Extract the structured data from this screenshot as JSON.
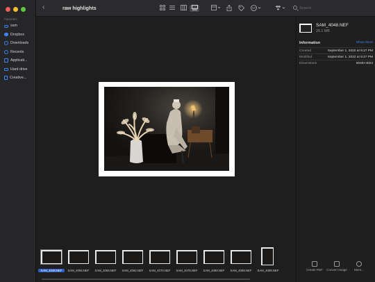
{
  "window": {
    "title": "raw highlights"
  },
  "sidebar": {
    "section": "Favorites",
    "items": [
      {
        "label": "sam",
        "icon": "cloud-icon"
      },
      {
        "label": "Dropbox",
        "icon": "dropbox-icon"
      },
      {
        "label": "Downloads",
        "icon": "downloads-icon"
      },
      {
        "label": "Recents",
        "icon": "clock-icon"
      },
      {
        "label": "Applicati...",
        "icon": "applications-icon"
      },
      {
        "label": "Hard drive",
        "icon": "drive-icon"
      },
      {
        "label": "Creative...",
        "icon": "document-icon"
      }
    ]
  },
  "toolbar": {
    "back_glyph": "‹",
    "search_placeholder": "Search",
    "icons": [
      "icon-view-icon",
      "list-view-icon",
      "column-view-icon",
      "gallery-view-icon",
      "group-icon",
      "share-icon",
      "tag-icon",
      "action-icon",
      "dropbox-icon",
      "search-icon"
    ]
  },
  "inspector": {
    "file_name": "SAM_4048.NEF",
    "file_size": "26.1 MB",
    "info_title": "Information",
    "show_more": "Show More",
    "rows": [
      {
        "key": "Created",
        "value": "September 1, 2022 at 9:27 PM"
      },
      {
        "key": "Modified",
        "value": "September 1, 2022 at 9:27 PM"
      },
      {
        "key": "Dimensions",
        "value": "6048×4024"
      }
    ],
    "actions": [
      {
        "label": "Create PDF"
      },
      {
        "label": "Convert Image"
      },
      {
        "label": "More..."
      }
    ]
  },
  "filmstrip": {
    "items": [
      {
        "label": "SAM_4048.NEF",
        "selected": true
      },
      {
        "label": "SAM_4056.NEF"
      },
      {
        "label": "SAM_4059.NEF"
      },
      {
        "label": "SAM_4062.NEF"
      },
      {
        "label": "SAM_4070.NEF"
      },
      {
        "label": "SAM_4075.NEF"
      },
      {
        "label": "SAM_4080.NEF"
      },
      {
        "label": "SAM_4088.NEF"
      },
      {
        "label": "SAM_4089.NEF"
      }
    ]
  },
  "colors": {
    "accent": "#3a84f5",
    "selection": "#2e5fc7",
    "background": "#1e1e1e"
  }
}
